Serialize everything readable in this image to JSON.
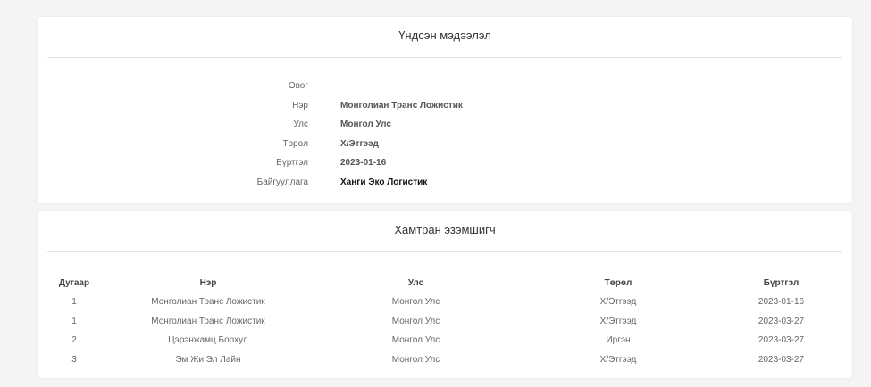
{
  "basic_info": {
    "title": "Үндсэн мэдээлэл",
    "rows": [
      {
        "label": "Овог",
        "value": ""
      },
      {
        "label": "Нэр",
        "value": "Монголиан Транс Ложистик"
      },
      {
        "label": "Улс",
        "value": "Монгол Улс"
      },
      {
        "label": "Төрөл",
        "value": "Х/Этгээд"
      },
      {
        "label": "Бүртгэл",
        "value": "2023-01-16"
      },
      {
        "label": "Байгууллага",
        "value": "Ханги Эко Логистик"
      }
    ]
  },
  "co_owners": {
    "title": "Хамтран эзэмшигч",
    "headers": {
      "number": "Дугаар",
      "name": "Нэр",
      "country": "Улс",
      "type": "Төрөл",
      "registration": "Бүртгэл"
    },
    "rows": [
      {
        "number": "1",
        "name": "Монголиан Транс Ложистик",
        "country": "Монгол Улс",
        "type": "Х/Этгээд",
        "registration": "2023-01-16"
      },
      {
        "number": "1",
        "name": "Монголиан Транс Ложистик",
        "country": "Монгол Улс",
        "type": "Х/Этгээд",
        "registration": "2023-03-27"
      },
      {
        "number": "2",
        "name": "Цэрэнжамц Борхул",
        "country": "Монгол Улс",
        "type": "Иргэн",
        "registration": "2023-03-27"
      },
      {
        "number": "3",
        "name": "Эм Жи Эл Лайн",
        "country": "Монгол Улс",
        "type": "Х/Этгээд",
        "registration": "2023-03-27"
      }
    ]
  }
}
